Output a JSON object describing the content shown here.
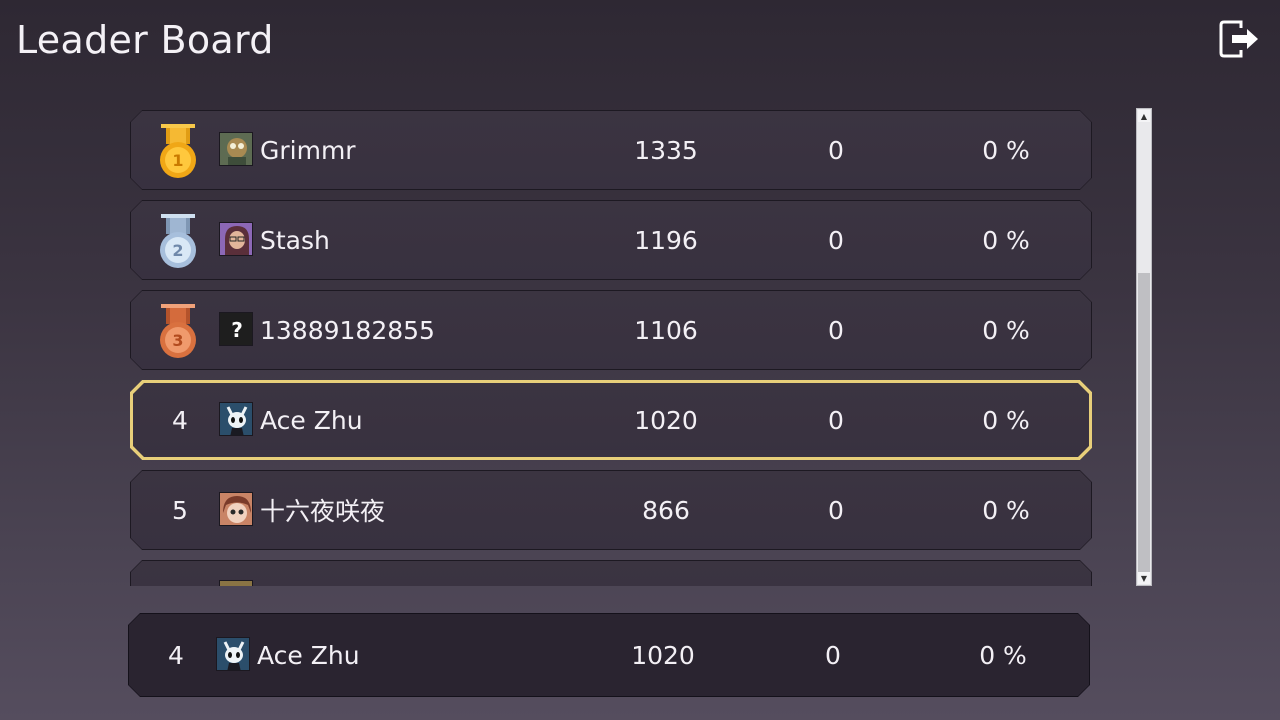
{
  "header": {
    "title": "Leader Board",
    "exit_icon": "exit-icon"
  },
  "leaderboard": {
    "rows": [
      {
        "rank": "1",
        "medal": "gold-medal-icon",
        "name": "Grimmr",
        "score": "1335",
        "wins": "0",
        "percent": "0 %",
        "avatar": "grimmr-avatar"
      },
      {
        "rank": "2",
        "medal": "silver-medal-icon",
        "name": "Stash",
        "score": "1196",
        "wins": "0",
        "percent": "0 %",
        "avatar": "stash-avatar"
      },
      {
        "rank": "3",
        "medal": "bronze-medal-icon",
        "name": "13889182855",
        "score": "1106",
        "wins": "0",
        "percent": "0 %",
        "avatar": "unknown-avatar"
      },
      {
        "rank": "4",
        "name": "Ace Zhu",
        "score": "1020",
        "wins": "0",
        "percent": "0 %",
        "avatar": "knight-avatar",
        "highlighted": true
      },
      {
        "rank": "5",
        "name": "十六夜咲夜",
        "score": "866",
        "wins": "0",
        "percent": "0 %",
        "avatar": "sakuya-avatar"
      }
    ]
  },
  "current_player": {
    "rank": "4",
    "name": "Ace Zhu",
    "score": "1020",
    "wins": "0",
    "percent": "0 %",
    "avatar": "knight-avatar"
  },
  "colors": {
    "highlight_border": "#e8cf7a",
    "gold": "#f2b422",
    "silver": "#b9cfe6",
    "bronze": "#de7c4b"
  }
}
